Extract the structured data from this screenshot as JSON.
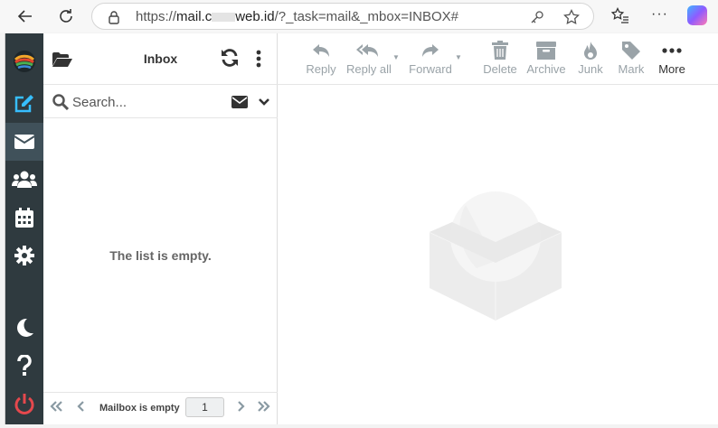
{
  "browser": {
    "url_prefix": "https://",
    "url_host": "mail.c",
    "url_host_rest": "web.id",
    "url_path": "/?_task=mail&_mbox=INBOX#"
  },
  "taskmenu": {
    "items": [
      {
        "name": "compose"
      },
      {
        "name": "mail",
        "selected": true
      },
      {
        "name": "contacts"
      },
      {
        "name": "calendar"
      },
      {
        "name": "settings"
      },
      {
        "name": "dark-mode"
      },
      {
        "name": "help"
      },
      {
        "name": "logout"
      }
    ],
    "accent": "#37beff",
    "logout_color": "#e5484d"
  },
  "list": {
    "title": "Inbox",
    "search_placeholder": "Search...",
    "empty_message": "The list is empty.",
    "pager_text": "Mailbox is empty",
    "page_number": "1"
  },
  "toolbar": {
    "reply": "Reply",
    "reply_all": "Reply all",
    "forward": "Forward",
    "delete": "Delete",
    "archive": "Archive",
    "junk": "Junk",
    "mark": "Mark",
    "more": "More"
  }
}
